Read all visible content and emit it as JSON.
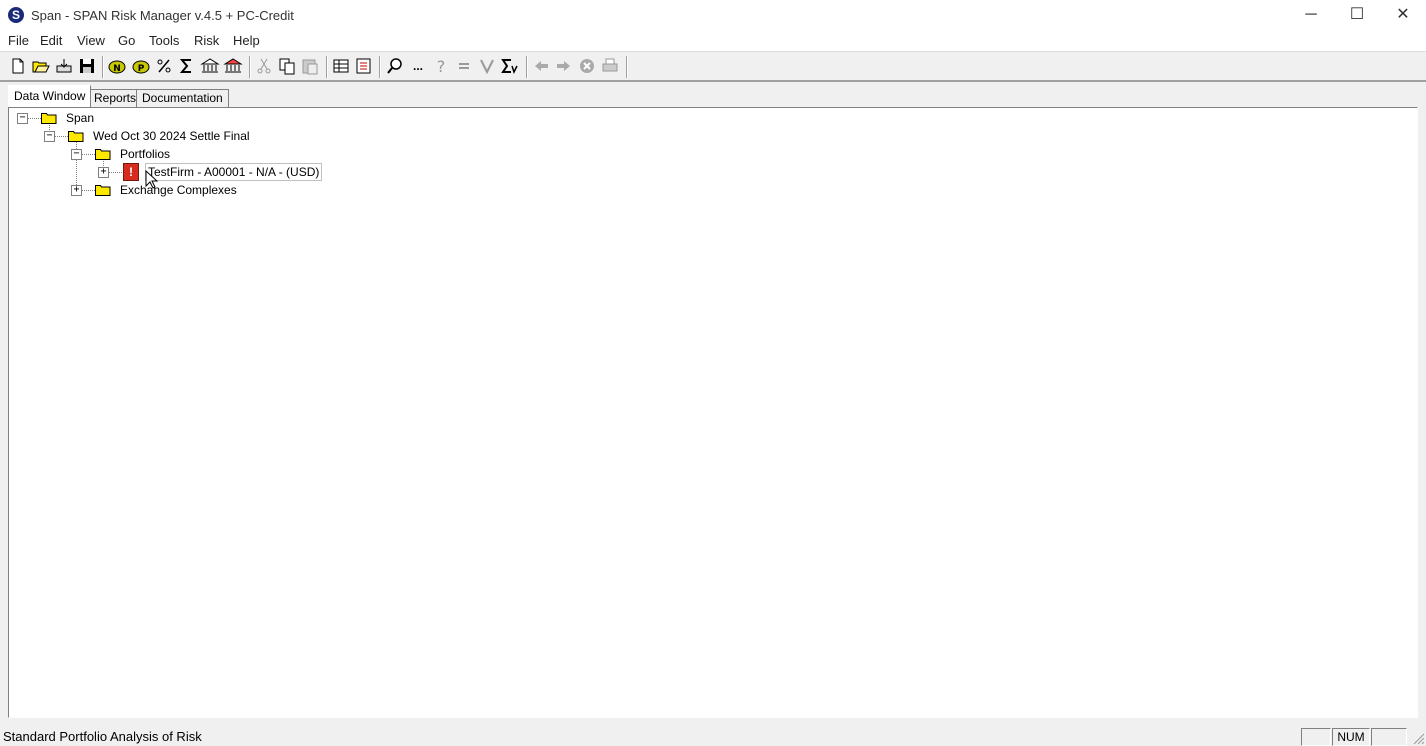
{
  "window": {
    "title": "Span - SPAN Risk Manager v.4.5 + PC-Credit",
    "app_icon_letter": "S",
    "controls": {
      "minimize": "─",
      "maximize": "☐",
      "close": "✕"
    }
  },
  "menu": [
    "File",
    "Edit",
    "View",
    "Go",
    "Tools",
    "Risk",
    "Help"
  ],
  "toolbar": {
    "icons": [
      "new-icon",
      "open-icon",
      "import-icon",
      "save-icon",
      "n-icon",
      "p-icon",
      "percent-icon",
      "sigma-icon",
      "bank-icon",
      "bank-red-icon",
      "cut-icon",
      "copy-icon",
      "paste-icon",
      "grid-icon",
      "report-icon",
      "find-icon",
      "more-icon",
      "help-icon",
      "equals-icon",
      "v-icon",
      "sigma-v-icon",
      "back-icon",
      "forward-icon",
      "stop-icon",
      "print-icon"
    ],
    "more_label": "..."
  },
  "tabs": [
    "Data Window",
    "Reports",
    "Documentation"
  ],
  "tree": {
    "root": "Span",
    "date_node": "Wed Oct 30 2024 Settle Final",
    "portfolios": "Portfolios",
    "firm": "TestFirm - A00001 - N/A - (USD)",
    "exchange": "Exchange Complexes",
    "warn_glyph": "!"
  },
  "status": {
    "text": "Standard Portfolio Analysis of Risk",
    "panes": [
      "",
      "NUM",
      ""
    ]
  },
  "colors": {
    "folder": "#ffe800",
    "warning": "#d62c1f",
    "selected_border": "#c0c0c0"
  }
}
